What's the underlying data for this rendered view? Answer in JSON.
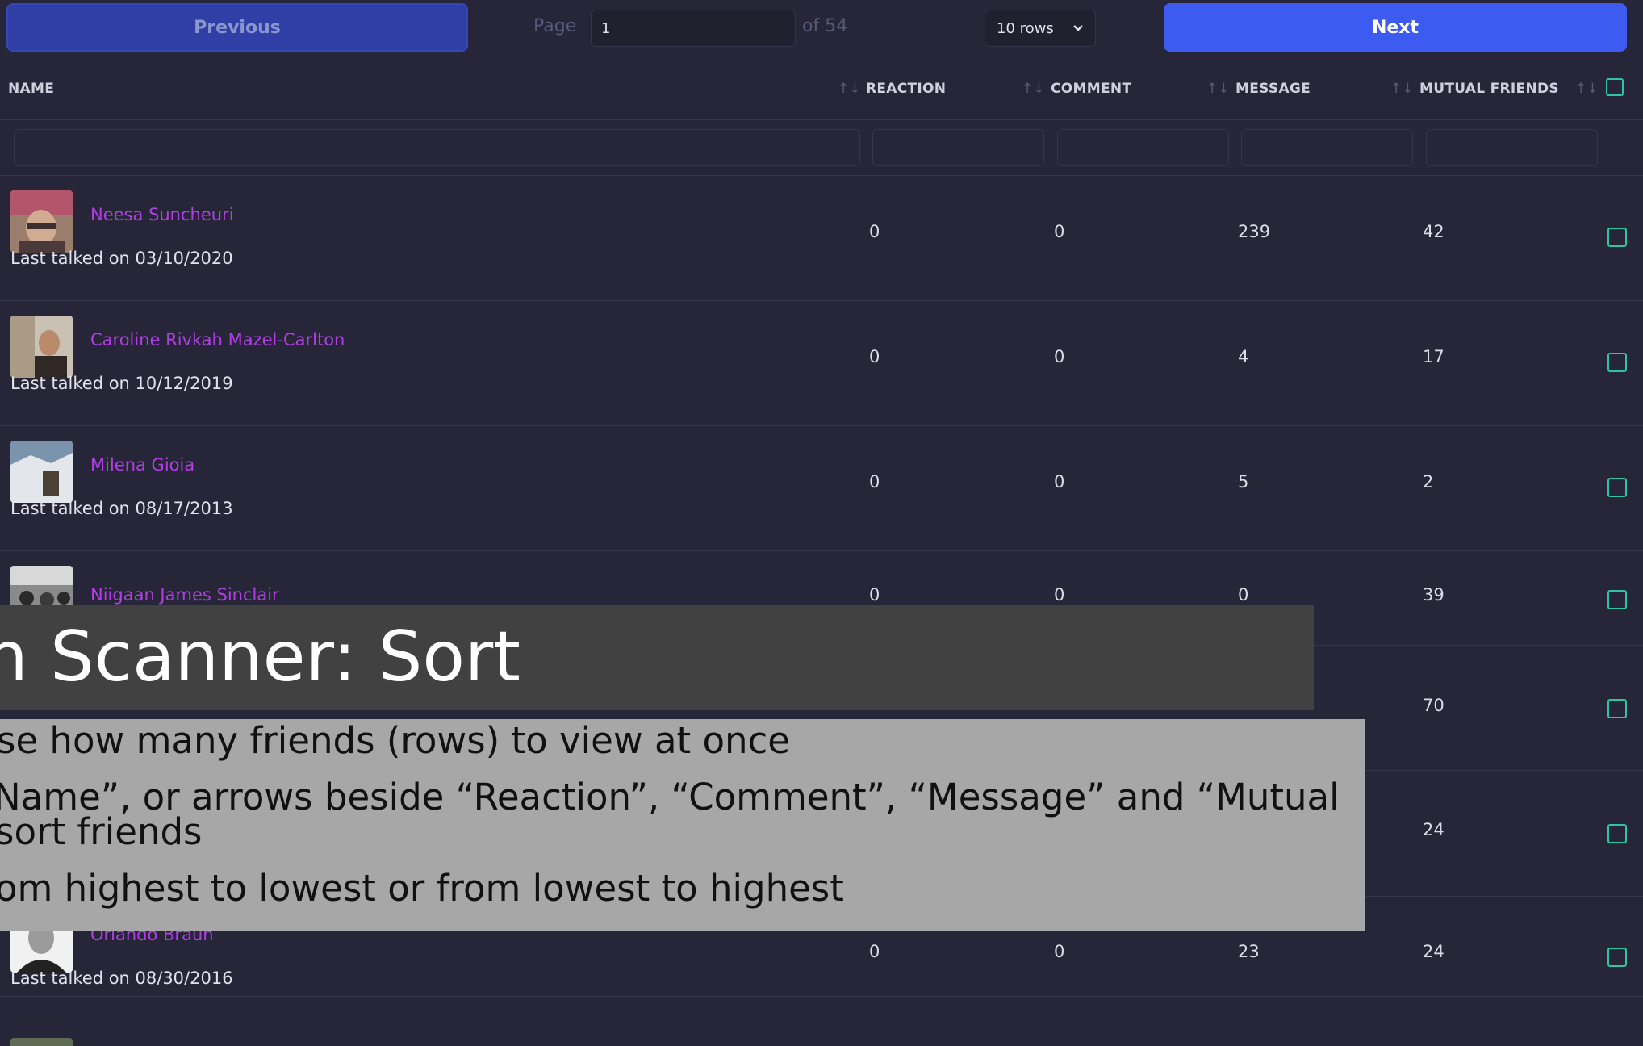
{
  "pagination": {
    "previous_label": "Previous",
    "next_label": "Next",
    "page_label": "Page",
    "page_value": "1",
    "of_label": "of 54",
    "rows_value": "10 rows"
  },
  "columns": {
    "name": "NAME",
    "reaction": "REACTION",
    "comment": "COMMENT",
    "message": "MESSAGE",
    "mutual": "MUTUAL FRIENDS",
    "sort_glyph": "↑↓"
  },
  "rows": [
    {
      "name": "Neesa Suncheuri",
      "last": "Last talked on 03/10/2020",
      "reaction": "0",
      "comment": "0",
      "message": "239",
      "mutual": "42"
    },
    {
      "name": "Caroline Rivkah Mazel-Carlton",
      "last": "Last talked on 10/12/2019",
      "reaction": "0",
      "comment": "0",
      "message": "4",
      "mutual": "17"
    },
    {
      "name": "Milena Gioia",
      "last": "Last talked on 08/17/2013",
      "reaction": "0",
      "comment": "0",
      "message": "5",
      "mutual": "2"
    },
    {
      "name": "Niigaan James Sinclair",
      "last": "",
      "reaction": "0",
      "comment": "0",
      "message": "0",
      "mutual": "39"
    },
    {
      "name": "",
      "last": "",
      "reaction": "",
      "comment": "",
      "message": "",
      "mutual": "70"
    },
    {
      "name": "",
      "last": "",
      "reaction": "",
      "comment": "",
      "message": "",
      "mutual": "24"
    },
    {
      "name": "Orlando Braun",
      "last": "Last talked on 08/30/2016",
      "reaction": "0",
      "comment": "0",
      "message": "23",
      "mutual": "24"
    }
  ],
  "overlay": {
    "title": "tion Scanner: Sort",
    "line1": "se how many friends (rows) to view at once",
    "line2": "Name”, or arrows beside “Reaction”, “Comment”, “Message” and “Mutual",
    "line3": "sort friends",
    "line4": "om highest to lowest or from lowest to highest"
  },
  "colors": {
    "background": "#262638",
    "accent": "#3d5af1",
    "name_link": "#b23ee6",
    "checkbox": "#2ec4a7"
  }
}
